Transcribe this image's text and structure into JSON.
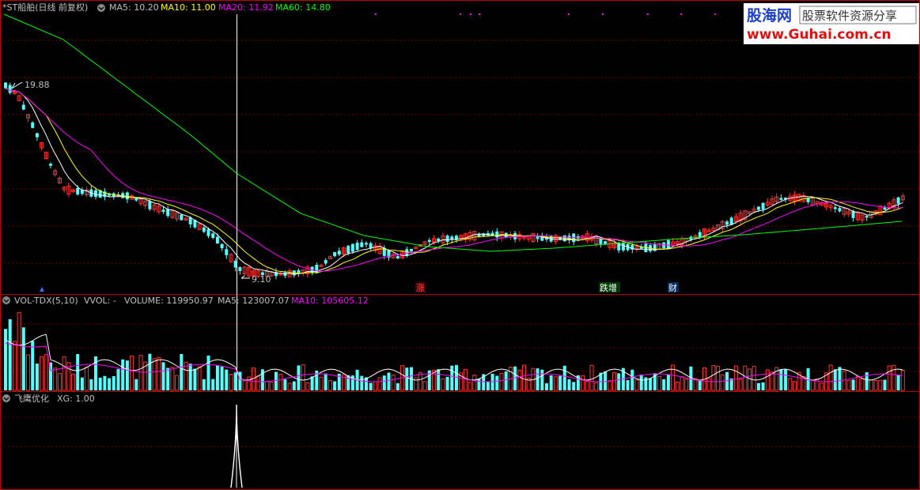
{
  "header": {
    "title": "*ST船舶(日线 前复权)",
    "ma5": "MA5: 10.20",
    "ma10": "MA10: 11.00",
    "ma20": "MA20: 11.92",
    "ma60": "MA60: 14.80"
  },
  "price_panel": {
    "high_label": "19.88",
    "low_label": "9.10",
    "event_labels": [
      "涨",
      "跌增",
      "财"
    ]
  },
  "volume_panel": {
    "title": "VOL-TDX(5,10)",
    "vvol": "VVOL: -",
    "volume": "VOLUME: 119950.97",
    "ma5": "MA5: 123007.07",
    "ma10": "MA10: 105605.12"
  },
  "indicator_panel": {
    "title": "飞鹰优化",
    "xg": "XG: 1.00"
  },
  "watermark": {
    "brand": "股海网",
    "slogan": "股票软件资源分享",
    "url": "www.Guhai.com.cn"
  },
  "colors": {
    "background": "#000000",
    "up": "#ff3232",
    "down": "#54ffff",
    "ma5": "#ffffff",
    "ma10": "#ffff00",
    "ma20": "#ff00ff",
    "ma60": "#00ff00",
    "grid": "#7a0000",
    "border": "#c00000"
  }
}
